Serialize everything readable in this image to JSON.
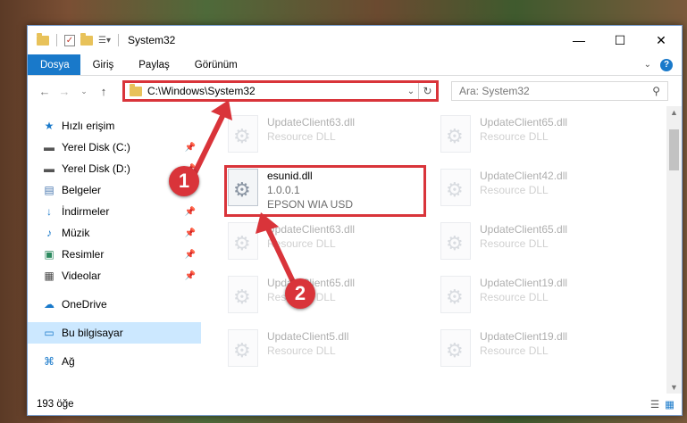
{
  "window": {
    "title": "System32",
    "controls": {
      "minimize": "—",
      "maximize": "☐",
      "close": "✕"
    }
  },
  "ribbon": {
    "tabs": [
      {
        "label": "Dosya"
      },
      {
        "label": "Giriş"
      },
      {
        "label": "Paylaş"
      },
      {
        "label": "Görünüm"
      }
    ]
  },
  "address": {
    "path": "C:\\Windows\\System32",
    "search_placeholder": "Ara: System32"
  },
  "sidebar": {
    "items": [
      {
        "label": "Hızlı erişim",
        "icon": "star-icon"
      },
      {
        "label": "Yerel Disk (C:)",
        "icon": "drive-icon"
      },
      {
        "label": "Yerel Disk (D:)",
        "icon": "drive-icon"
      },
      {
        "label": "Belgeler",
        "icon": "documents-icon"
      },
      {
        "label": "İndirmeler",
        "icon": "download-icon"
      },
      {
        "label": "Müzik",
        "icon": "music-icon"
      },
      {
        "label": "Resimler",
        "icon": "pictures-icon"
      },
      {
        "label": "Videolar",
        "icon": "video-icon"
      },
      {
        "label": "OneDrive",
        "icon": "cloud-icon"
      },
      {
        "label": "Bu bilgisayar",
        "icon": "computer-icon"
      },
      {
        "label": "Ağ",
        "icon": "network-icon"
      }
    ]
  },
  "files": [
    {
      "name": "UpdateClient63.dll",
      "line2": "Resource DLL"
    },
    {
      "name": "UpdateClient65.dll",
      "line2": "Resource DLL"
    },
    {
      "name": "esunid.dll",
      "line2": "1.0.0.1",
      "line3": "EPSON WIA USD"
    },
    {
      "name": "UpdateClient42.dll",
      "line2": "Resource DLL"
    },
    {
      "name": "UpdateClient63.dll",
      "line2": "Resource DLL"
    },
    {
      "name": "UpdateClient65.dll",
      "line2": "Resource DLL"
    },
    {
      "name": "UpdateClient65.dll",
      "line2": "Resource DLL"
    },
    {
      "name": "UpdateClient19.dll",
      "line2": "Resource DLL"
    },
    {
      "name": "UpdateClient5.dll",
      "line2": "Resource DLL"
    },
    {
      "name": "UpdateClient19.dll",
      "line2": "Resource DLL"
    }
  ],
  "status": {
    "count": "193 öğe"
  },
  "annotations": {
    "step1": "1",
    "step2": "2",
    "color": "#d9343a"
  }
}
